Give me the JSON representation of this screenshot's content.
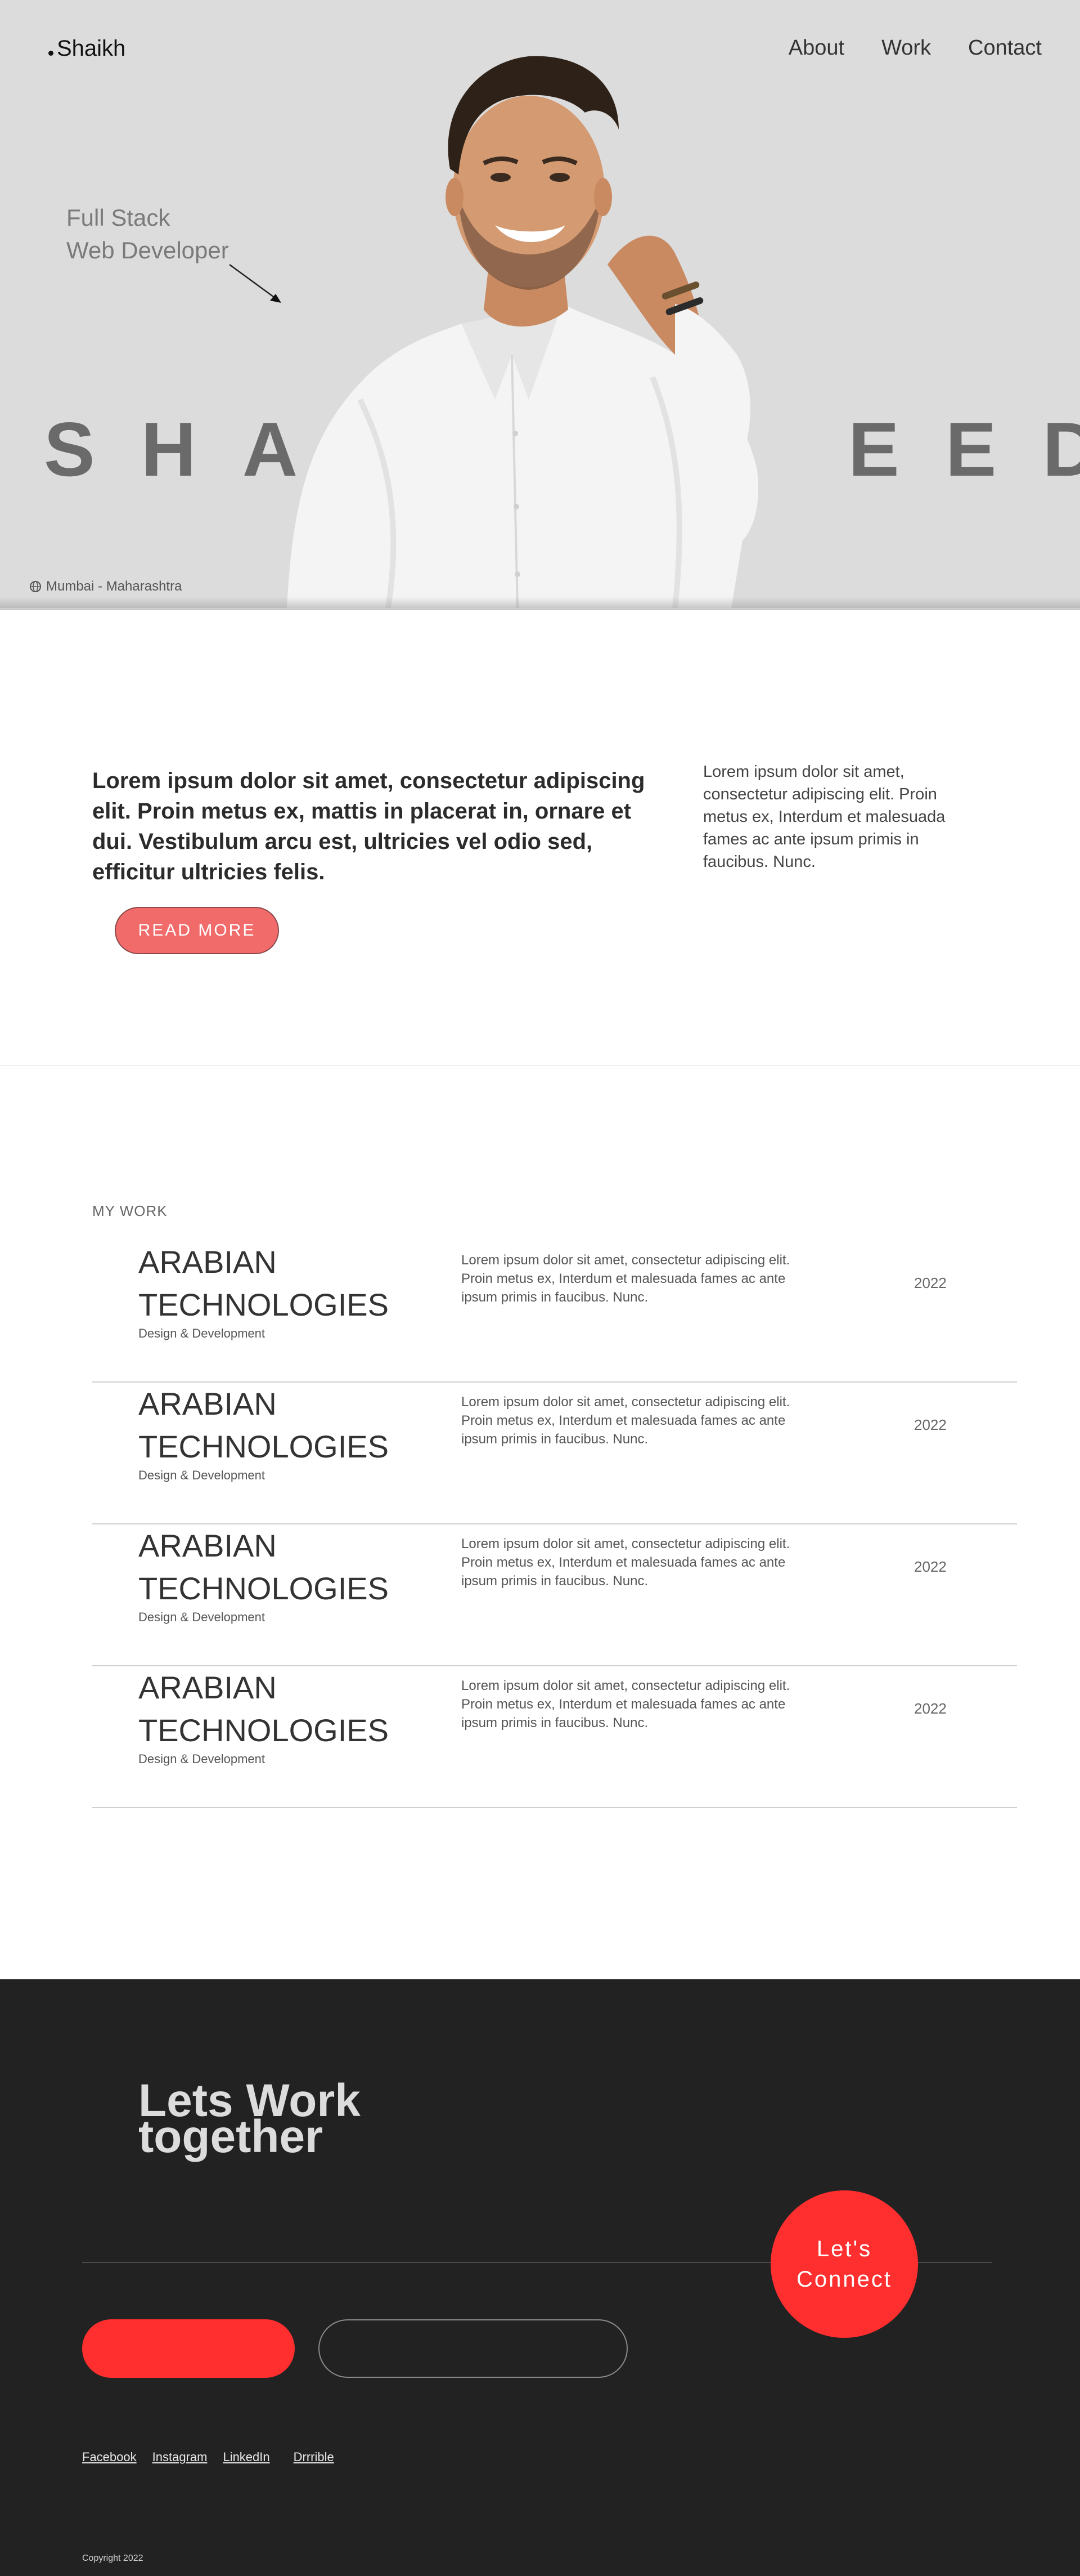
{
  "header": {
    "logo": "Shaikh",
    "nav": [
      "About",
      "Work",
      "Contact"
    ]
  },
  "hero": {
    "tagline_line1": "Full Stack",
    "tagline_line2": "Web Developer",
    "name_left": "SHA",
    "name_right": "EED",
    "location": "Mumbai - Maharashtra",
    "bg_color": "#dcdcdc"
  },
  "intro": {
    "lead": "Lorem ipsum dolor sit amet, consectetur adipiscing elit. Proin metus ex, mattis in placerat in, ornare et dui. Vestibulum arcu est, ultricies vel odio sed, efficitur ultricies felis.",
    "side": "Lorem ipsum dolor sit amet, consectetur adipiscing elit. Proin metus ex, Interdum et malesuada fames ac ante ipsum primis in faucibus. Nunc.",
    "read_more": "READ MORE",
    "accent": "#f26b6b"
  },
  "work": {
    "heading": "MY WORK",
    "items": [
      {
        "title_line1": "ARABIAN",
        "title_line2": "TECHNOLOGIES",
        "subtitle": "Design & Development",
        "description": "Lorem ipsum dolor sit amet, consectetur adipiscing elit. Proin metus ex, Interdum et malesuada fames ac ante ipsum primis in faucibus. Nunc.",
        "year": "2022"
      },
      {
        "title_line1": "ARABIAN",
        "title_line2": "TECHNOLOGIES",
        "subtitle": "Design & Development",
        "description": "Lorem ipsum dolor sit amet, consectetur adipiscing elit. Proin metus ex, Interdum et malesuada fames ac ante ipsum primis in faucibus. Nunc.",
        "year": "2022"
      },
      {
        "title_line1": "ARABIAN",
        "title_line2": "TECHNOLOGIES",
        "subtitle": "Design & Development",
        "description": "Lorem ipsum dolor sit amet, consectetur adipiscing elit. Proin metus ex, Interdum et malesuada fames ac ante ipsum primis in faucibus. Nunc.",
        "year": "2022"
      },
      {
        "title_line1": "ARABIAN",
        "title_line2": "TECHNOLOGIES",
        "subtitle": "Design & Development",
        "description": "Lorem ipsum dolor sit amet, consectetur adipiscing elit. Proin metus ex, Interdum et malesuada fames ac ante ipsum primis in faucibus. Nunc.",
        "year": "2022"
      }
    ]
  },
  "footer": {
    "title_line1": "Lets Work",
    "title_line2": "together",
    "connect_line1": "Let's",
    "connect_line2": "Connect",
    "email_button": "",
    "phone_button": "",
    "socials": [
      "Facebook",
      "Instagram",
      "LinkedIn",
      "Drrrible"
    ],
    "copyright": "Copyright 2022",
    "bg_color": "#222222",
    "accent": "#ff2f2f"
  },
  "icons": {
    "location": "globe-icon",
    "arrow": "arrow-down-right-icon"
  }
}
